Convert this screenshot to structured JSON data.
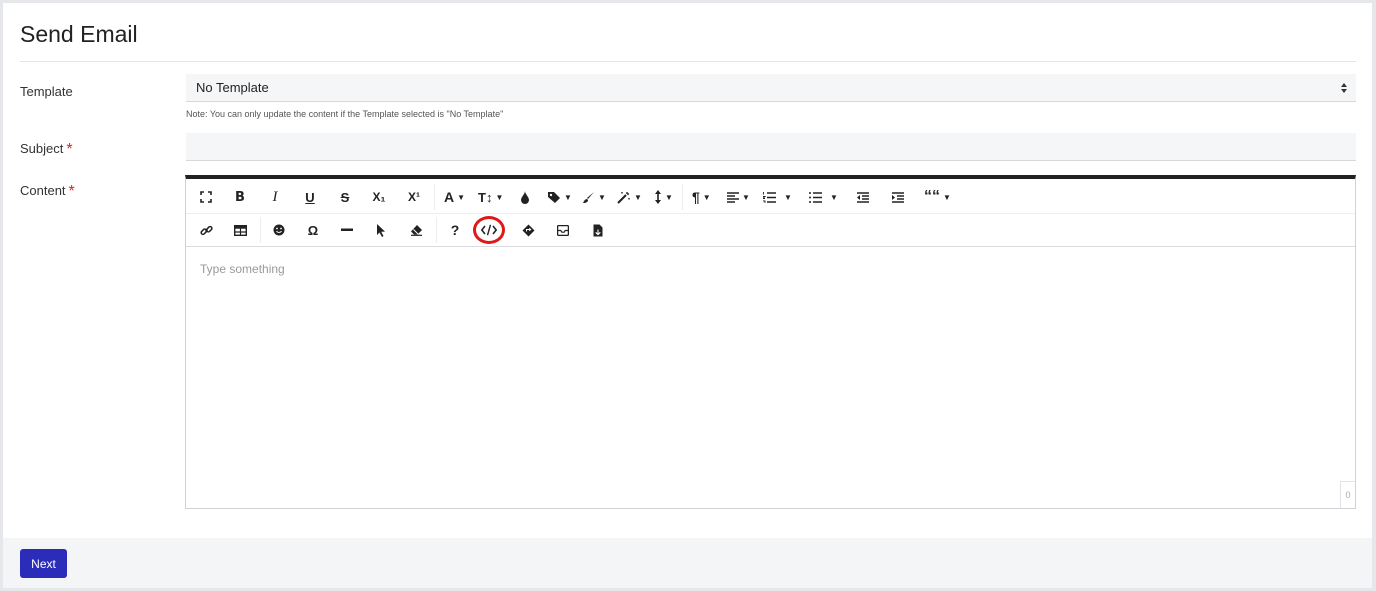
{
  "page": {
    "title": "Send Email"
  },
  "form": {
    "template": {
      "label": "Template",
      "selected": "No Template",
      "note": "Note: You can only update the content if the Template selected is \"No Template\""
    },
    "subject": {
      "label": "Subject",
      "required_mark": "*",
      "value": ""
    },
    "content": {
      "label": "Content",
      "required_mark": "*",
      "placeholder": "Type something",
      "char_count": "0"
    }
  },
  "toolbar": {
    "row1": [
      "fullscreen-icon",
      "bold-icon",
      "italic-icon",
      "underline-icon",
      "strikethrough-icon",
      "subscript-icon",
      "superscript-icon",
      "font-family-icon",
      "font-size-icon",
      "text-color-icon",
      "tag-icon",
      "paint-brush-icon",
      "magic-wand-icon",
      "line-height-icon",
      "paragraph-icon",
      "align-icon",
      "ordered-list-icon",
      "unordered-list-icon",
      "outdent-icon",
      "indent-icon",
      "quote-icon"
    ],
    "row2": [
      "link-icon",
      "table-icon",
      "emoji-icon",
      "omega-icon",
      "horizontal-rule-icon",
      "pointer-icon",
      "eraser-icon",
      "help-icon",
      "code-view-icon",
      "diamond-icon",
      "envelope-icon",
      "file-icon"
    ],
    "glyphs": {
      "bold": "B",
      "italic": "I",
      "underline": "U",
      "strike": "S",
      "sub": "X₁",
      "sup": "X¹",
      "font": "A",
      "size": "T↕",
      "omega": "Ω",
      "help": "?",
      "quote": "““",
      "para": "¶"
    },
    "highlight_color": "#e01818"
  },
  "footer": {
    "next_label": "Next"
  },
  "colors": {
    "accent": "#2b2dba",
    "required": "#e02020"
  }
}
